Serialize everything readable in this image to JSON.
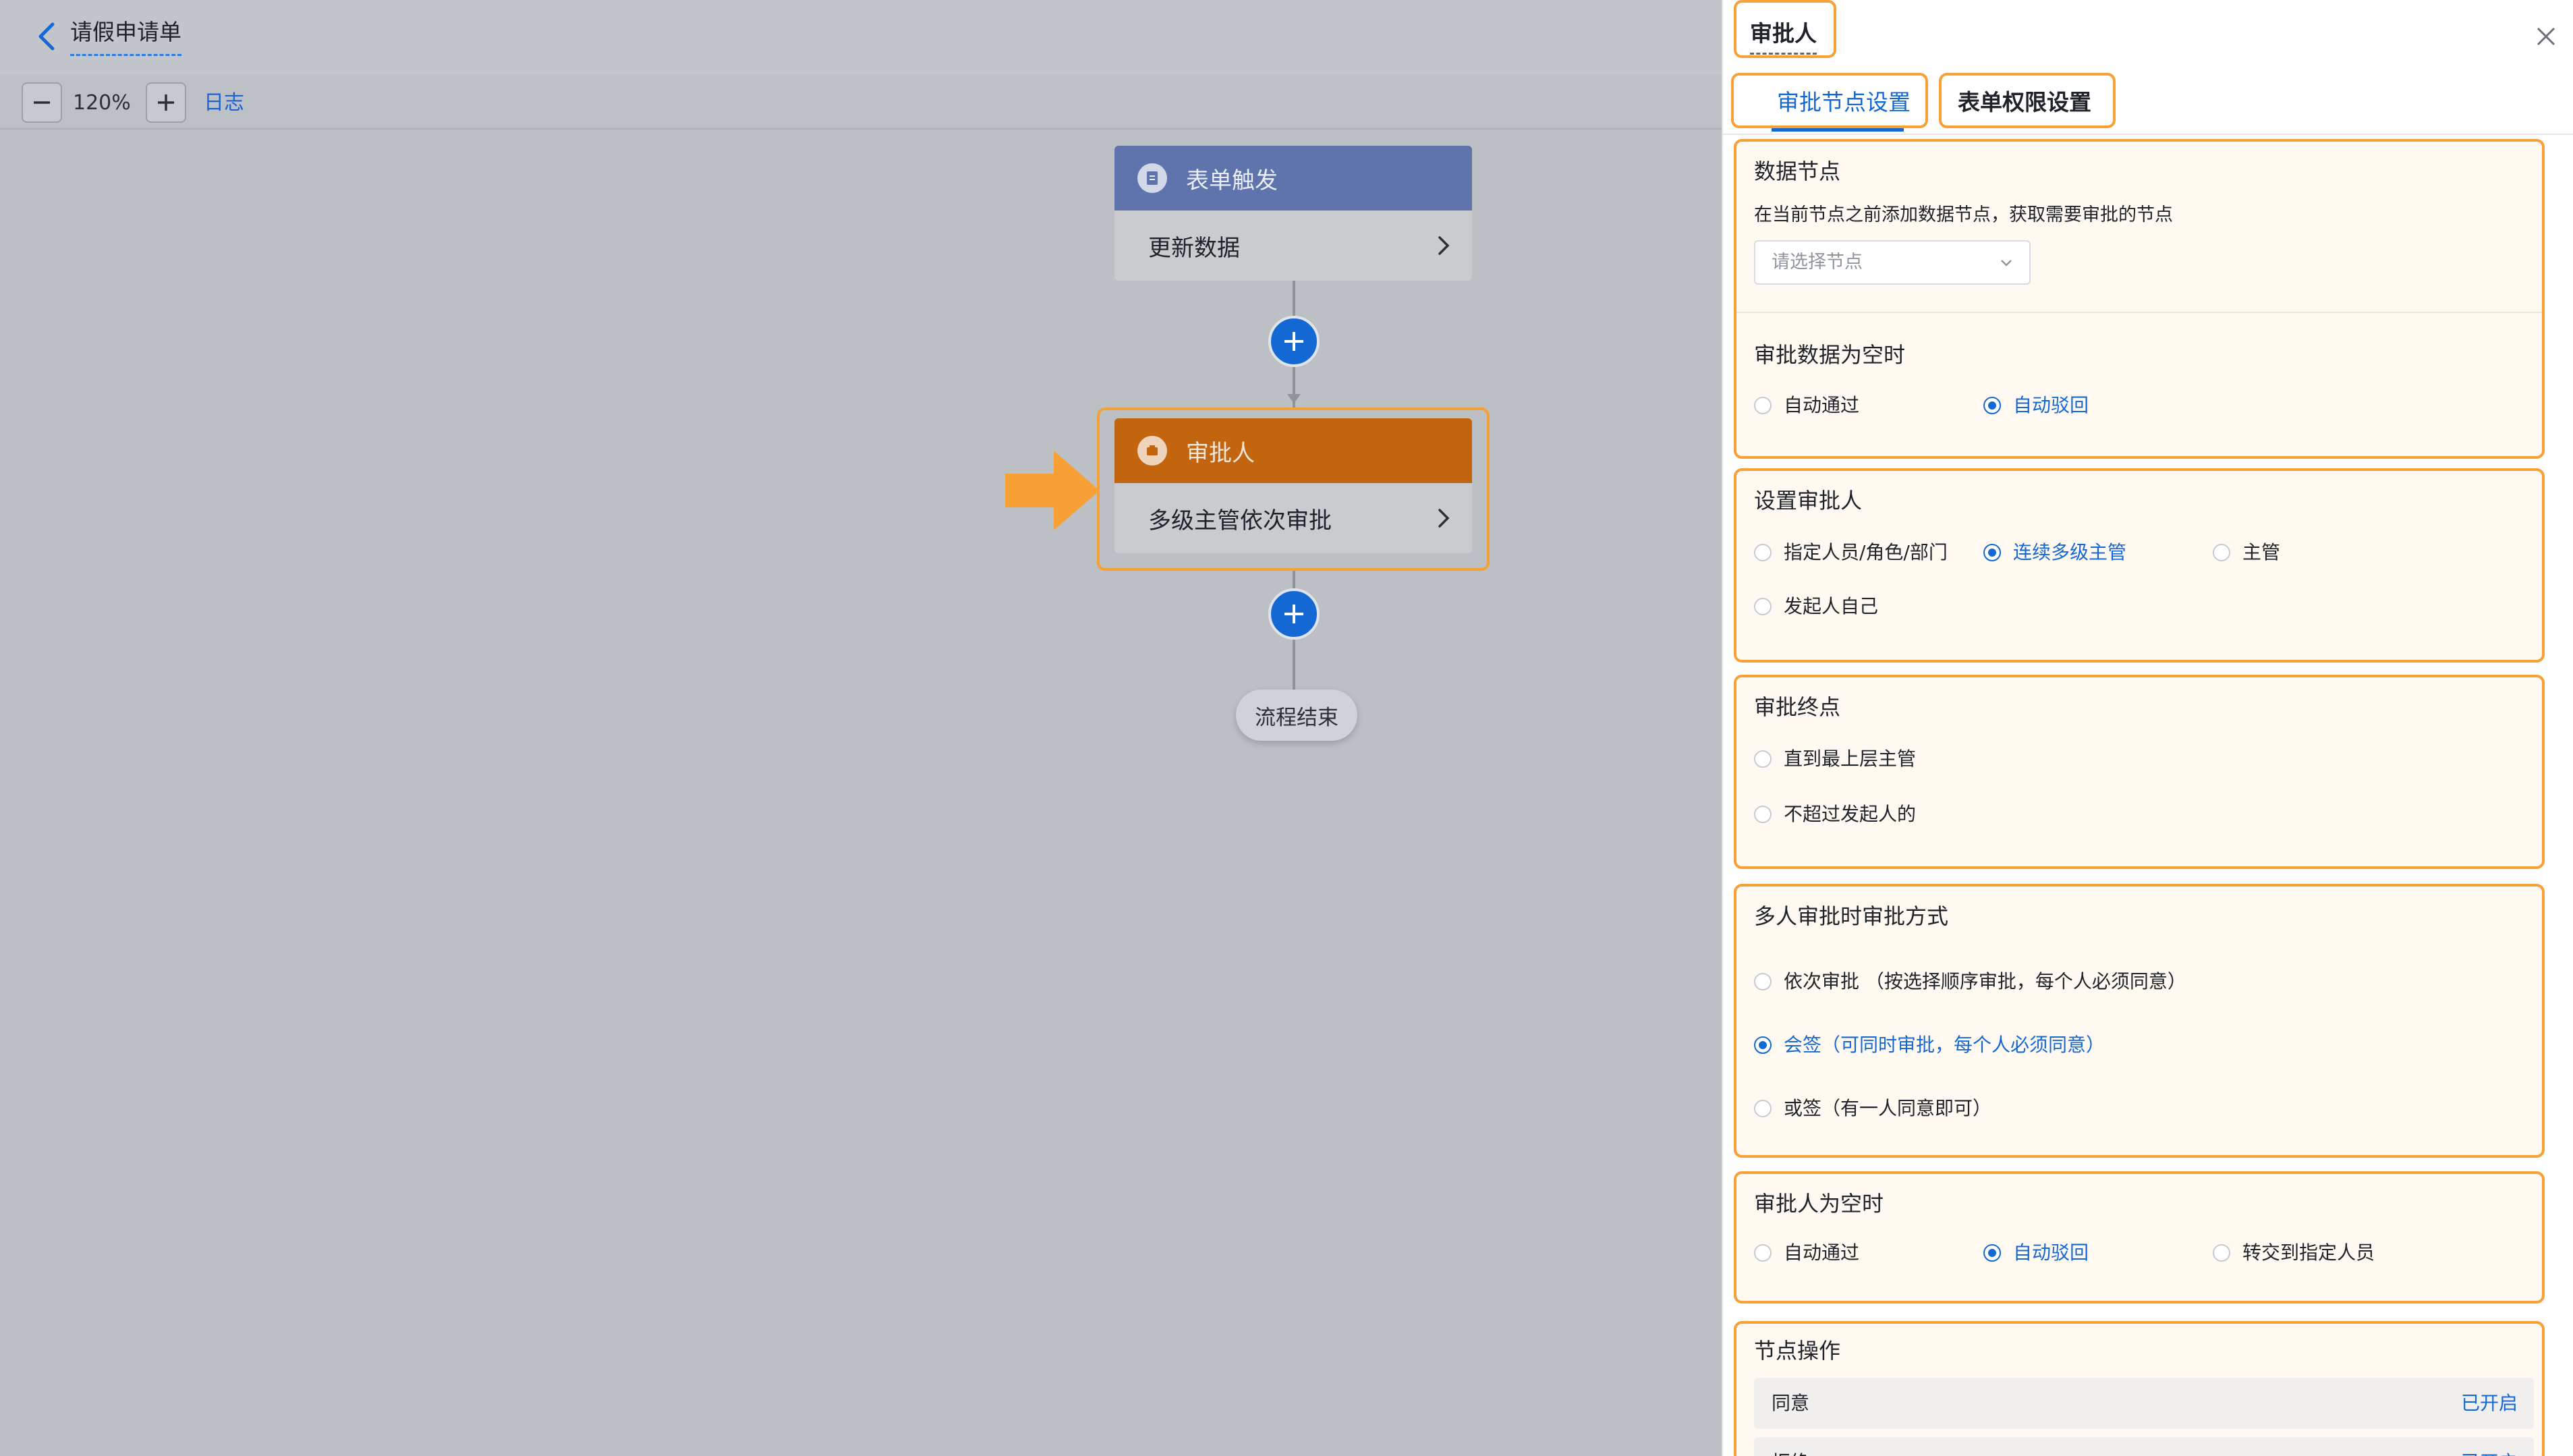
{
  "header": {
    "title": "请假申请单"
  },
  "toolbar": {
    "zoom": "120%",
    "log_label": "日志"
  },
  "canvas": {
    "trigger_node": {
      "title": "表单触发",
      "body": "更新数据"
    },
    "approver_node": {
      "title": "审批人",
      "body": "多级主管依次审批"
    },
    "end_label": "流程结束"
  },
  "panel": {
    "title": "审批人",
    "tabs": [
      {
        "label": "审批节点设置",
        "active": true
      },
      {
        "label": "表单权限设置",
        "active": false
      }
    ],
    "data_node": {
      "title": "数据节点",
      "desc": "在当前节点之前添加数据节点，获取需要审批的节点",
      "placeholder": "请选择节点"
    },
    "empty_data": {
      "title": "审批数据为空时",
      "options": [
        "自动通过",
        "自动驳回"
      ],
      "selected": "自动驳回"
    },
    "set_approver": {
      "title": "设置审批人",
      "options": [
        "指定人员/角色/部门",
        "连续多级主管",
        "主管",
        "发起人自己"
      ],
      "selected": "连续多级主管"
    },
    "approval_end": {
      "title": "审批终点",
      "options": [
        "直到最上层主管",
        "不超过发起人的"
      ],
      "selected": ""
    },
    "multi_mode": {
      "title": "多人审批时审批方式",
      "options": [
        "依次审批 （按选择顺序审批，每个人必须同意）",
        "会签（可同时审批，每个人必须同意）",
        "或签（有一人同意即可）"
      ],
      "selected": "会签（可同时审批，每个人必须同意）"
    },
    "empty_approver": {
      "title": "审批人为空时",
      "options": [
        "自动通过",
        "自动驳回",
        "转交到指定人员"
      ],
      "selected": "自动驳回"
    },
    "node_ops": {
      "title": "节点操作",
      "rows": [
        {
          "label": "同意",
          "status": "已开启"
        },
        {
          "label": "拒绝",
          "status": "已开启"
        }
      ]
    }
  },
  "colors": {
    "accent": "#1468d4",
    "highlight": "#f7a035",
    "trigger_header": "#5f74ad",
    "approver_header": "#c3640f"
  }
}
